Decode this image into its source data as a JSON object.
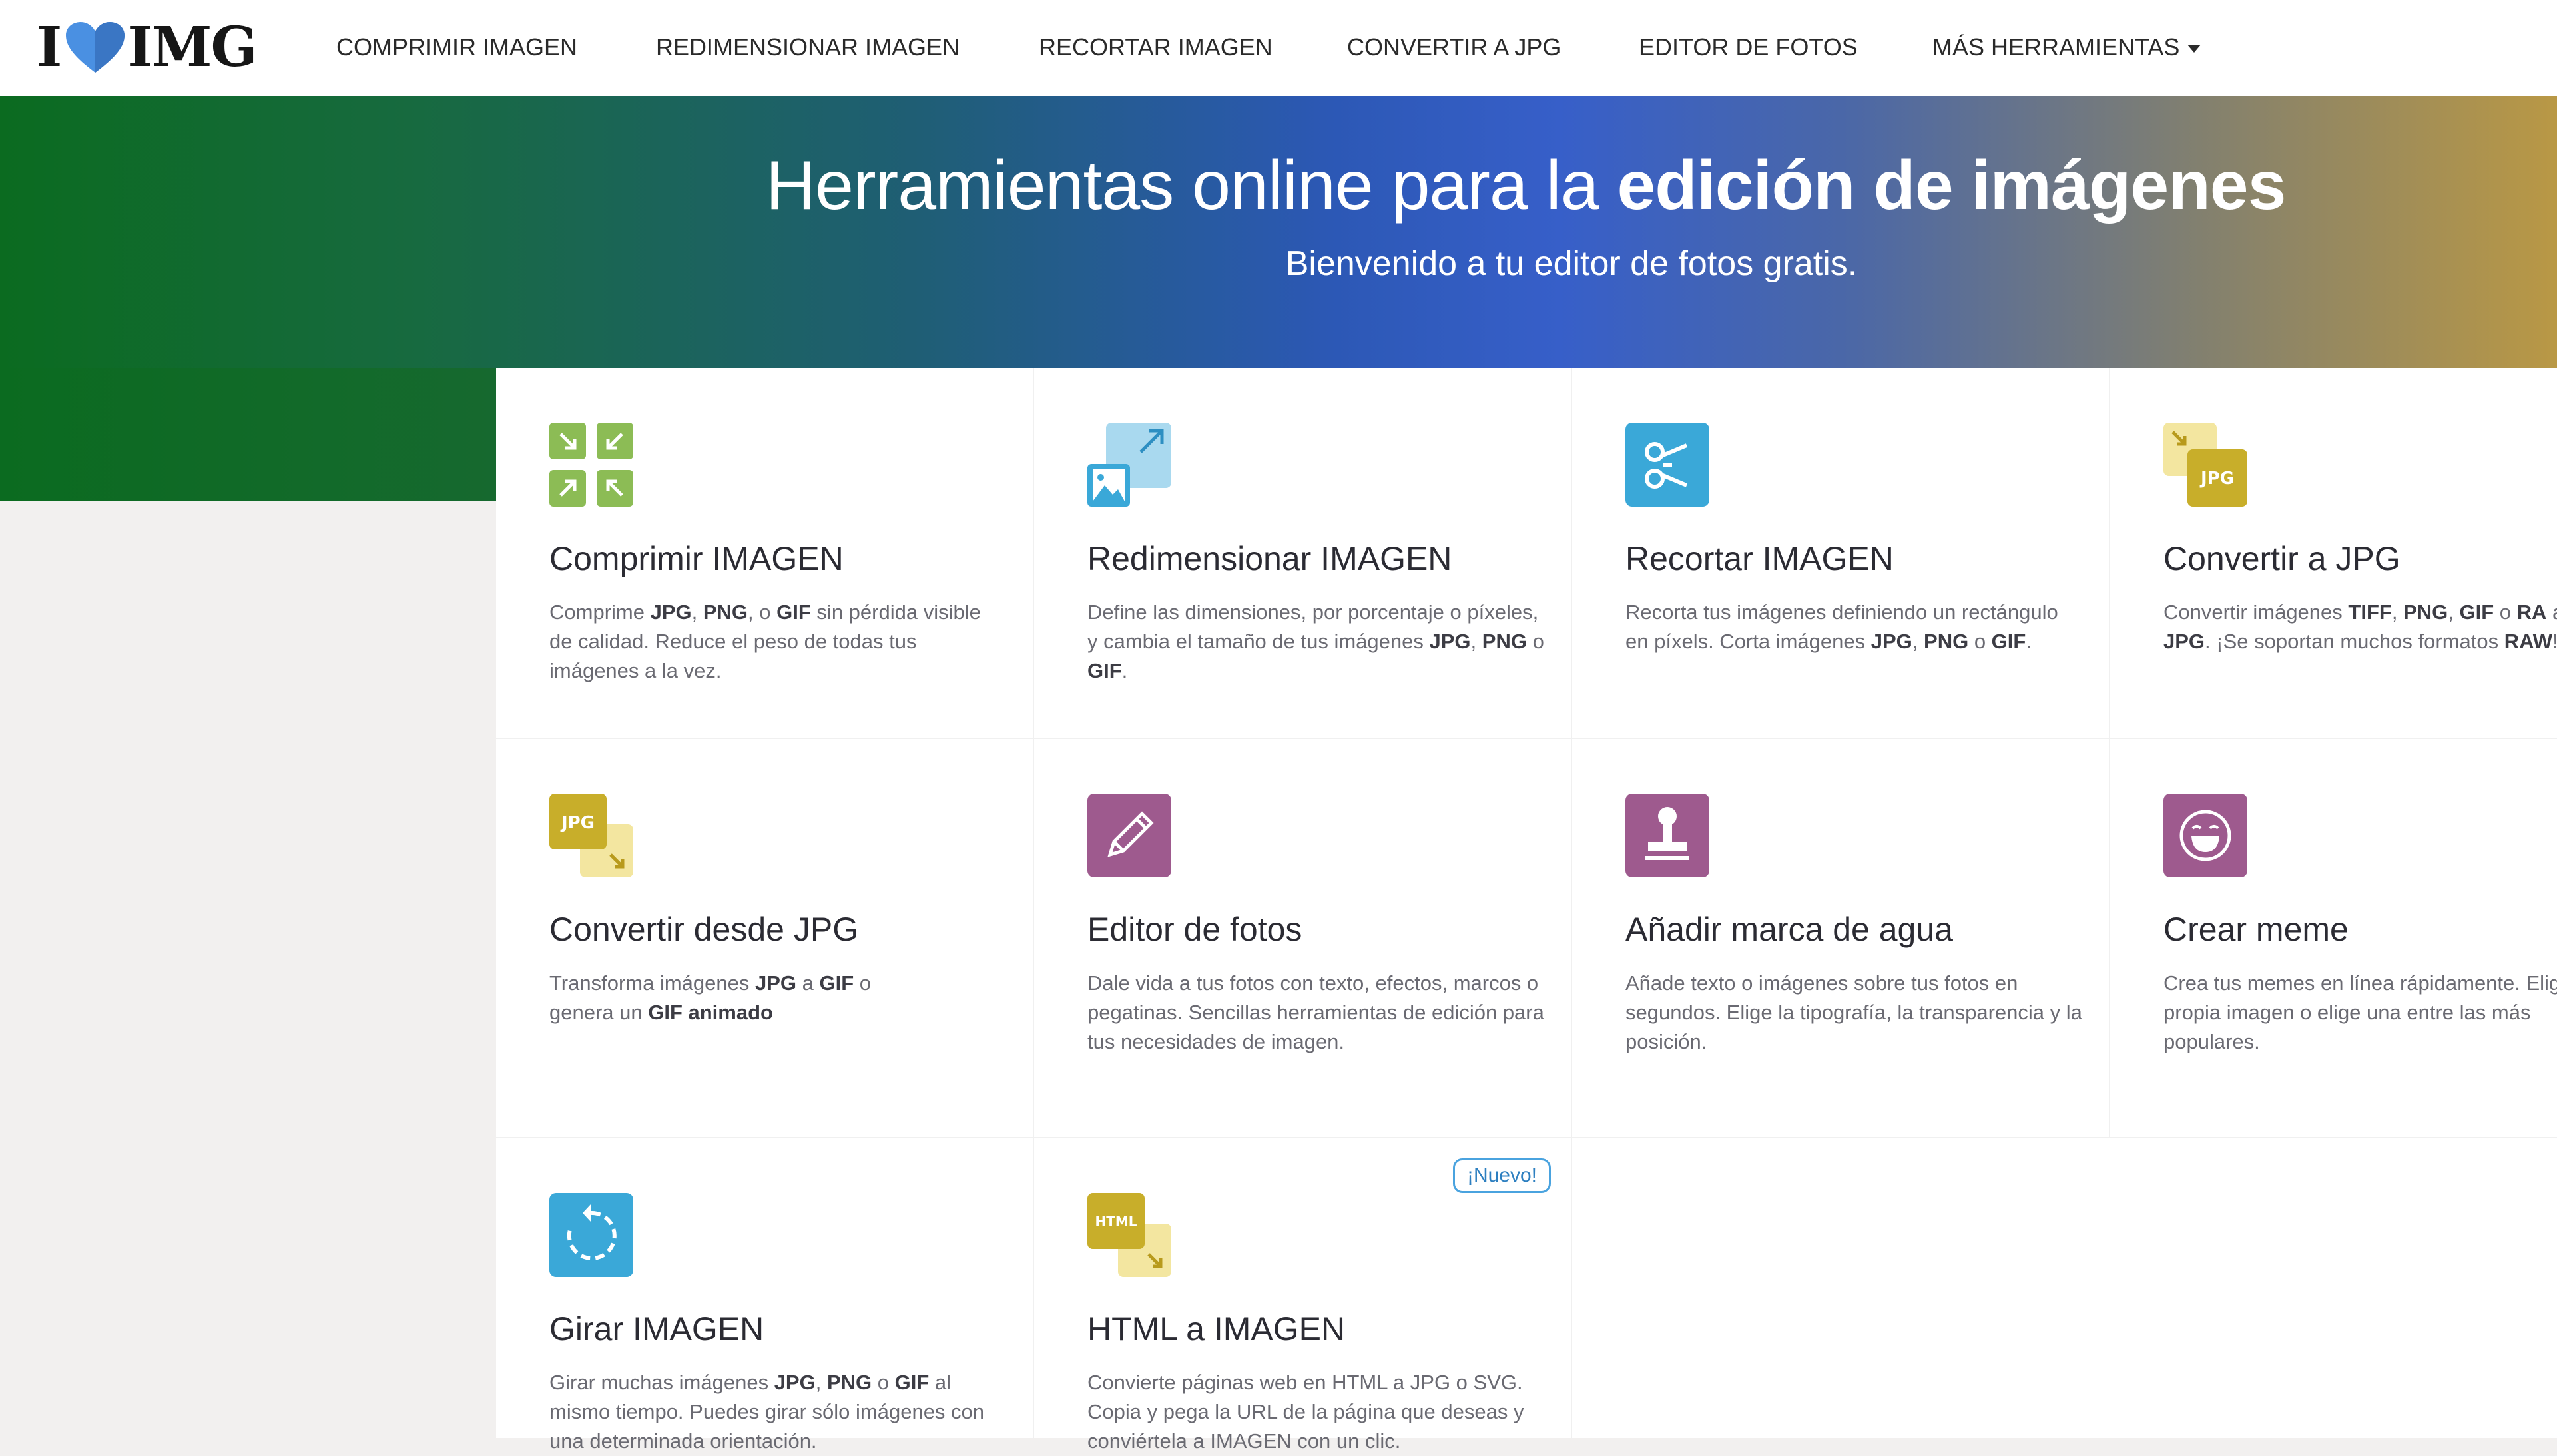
{
  "brand": {
    "logo_left": "I",
    "logo_right": "IMG",
    "heart_icon": "heart-icon",
    "accent": "#4a90e2"
  },
  "nav": {
    "items": [
      {
        "label": "COMPRIMIR IMAGEN"
      },
      {
        "label": "REDIMENSIONAR IMAGEN"
      },
      {
        "label": "RECORTAR IMAGEN"
      },
      {
        "label": "CONVERTIR A JPG"
      },
      {
        "label": "EDITOR DE FOTOS"
      },
      {
        "label": "MÁS HERRAMIENTAS"
      }
    ]
  },
  "hero": {
    "title_prefix": "Herramientas online para la ",
    "title_bold": "edición de imágenes",
    "subtitle": "Bienvenido a tu editor de fotos gratis."
  },
  "tools": [
    {
      "title": "Comprimir IMAGEN",
      "icon": "compress-icon",
      "color": "#8cbc55",
      "desc": [
        {
          "t": "Comprime "
        },
        {
          "t": "JPG",
          "b": true
        },
        {
          "t": ", "
        },
        {
          "t": "PNG",
          "b": true
        },
        {
          "t": ", o "
        },
        {
          "t": "GIF",
          "b": true
        },
        {
          "t": " sin pérdida visible de calidad. Reduce el peso de todas tus imágenes a la vez."
        }
      ]
    },
    {
      "title": "Redimensionar IMAGEN",
      "icon": "resize-icon",
      "color": "#3aa8d8",
      "desc": [
        {
          "t": "Define las dimensiones, por porcentaje o píxeles, y cambia el tamaño de tus imágenes "
        },
        {
          "t": "JPG",
          "b": true
        },
        {
          "t": ", "
        },
        {
          "t": "PNG",
          "b": true
        },
        {
          "t": " o "
        },
        {
          "t": "GIF",
          "b": true
        },
        {
          "t": "."
        }
      ]
    },
    {
      "title": "Recortar IMAGEN",
      "icon": "scissors-icon",
      "color": "#3aa8d8",
      "desc": [
        {
          "t": "Recorta tus imágenes definiendo un rectángulo en píxels. Corta imágenes "
        },
        {
          "t": "JPG",
          "b": true
        },
        {
          "t": ", "
        },
        {
          "t": "PNG",
          "b": true
        },
        {
          "t": " o "
        },
        {
          "t": "GIF",
          "b": true
        },
        {
          "t": "."
        }
      ]
    },
    {
      "title": "Convertir a JPG",
      "icon": "convert-to-jpg-icon",
      "color": "#c8ae2a",
      "desc": [
        {
          "t": "Convertir imágenes "
        },
        {
          "t": "TIFF",
          "b": true
        },
        {
          "t": ", "
        },
        {
          "t": "PNG",
          "b": true
        },
        {
          "t": ", "
        },
        {
          "t": "GIF",
          "b": true
        },
        {
          "t": " o "
        },
        {
          "t": "RA",
          "b": true
        },
        {
          "t": " a "
        },
        {
          "t": "JPG",
          "b": true
        },
        {
          "t": ". ¡Se soportan muchos formatos "
        },
        {
          "t": "RAW",
          "b": true
        },
        {
          "t": "!"
        }
      ]
    },
    {
      "title": "Convertir desde JPG",
      "icon": "convert-from-jpg-icon",
      "color": "#c8ae2a",
      "desc": [
        {
          "t": "Transforma imágenes "
        },
        {
          "t": "JPG",
          "b": true
        },
        {
          "t": " a "
        },
        {
          "t": "GIF",
          "b": true
        },
        {
          "t": " o genera un "
        },
        {
          "t": "GIF animado",
          "b": true
        }
      ]
    },
    {
      "title": "Editor de fotos",
      "icon": "pencil-icon",
      "color": "#9e5a8e",
      "desc": [
        {
          "t": "Dale vida a tus fotos con texto, efectos, marcos o pegatinas. Sencillas herramientas de edición para tus necesidades de imagen."
        }
      ]
    },
    {
      "title": "Añadir marca de agua",
      "icon": "stamp-icon",
      "color": "#9e5a8e",
      "desc": [
        {
          "t": "Añade texto o imágenes sobre tus fotos en segundos. Elige la tipografía, la transparencia y la posición."
        }
      ]
    },
    {
      "title": "Crear meme",
      "icon": "laughing-face-icon",
      "color": "#9e5a8e",
      "desc": [
        {
          "t": "Crea tus memes en línea rápidamente. Elige tu propia imagen o elige una entre las más populares."
        }
      ]
    },
    {
      "title": "Girar IMAGEN",
      "icon": "rotate-icon",
      "color": "#3aa8d8",
      "desc": [
        {
          "t": "Girar muchas imágenes "
        },
        {
          "t": "JPG",
          "b": true
        },
        {
          "t": ", "
        },
        {
          "t": "PNG",
          "b": true
        },
        {
          "t": " o "
        },
        {
          "t": "GIF",
          "b": true
        },
        {
          "t": " al mismo tiempo. Puedes girar sólo imágenes con una determinada orientación."
        }
      ]
    },
    {
      "title": "HTML a IMAGEN",
      "icon": "html-to-image-icon",
      "color": "#c8ae2a",
      "badge": "¡Nuevo!",
      "desc": [
        {
          "t": "Convierte páginas web en HTML a JPG o SVG. Copia y pega la URL de la página que deseas y conviértela a IMAGEN con un clic."
        }
      ]
    }
  ]
}
